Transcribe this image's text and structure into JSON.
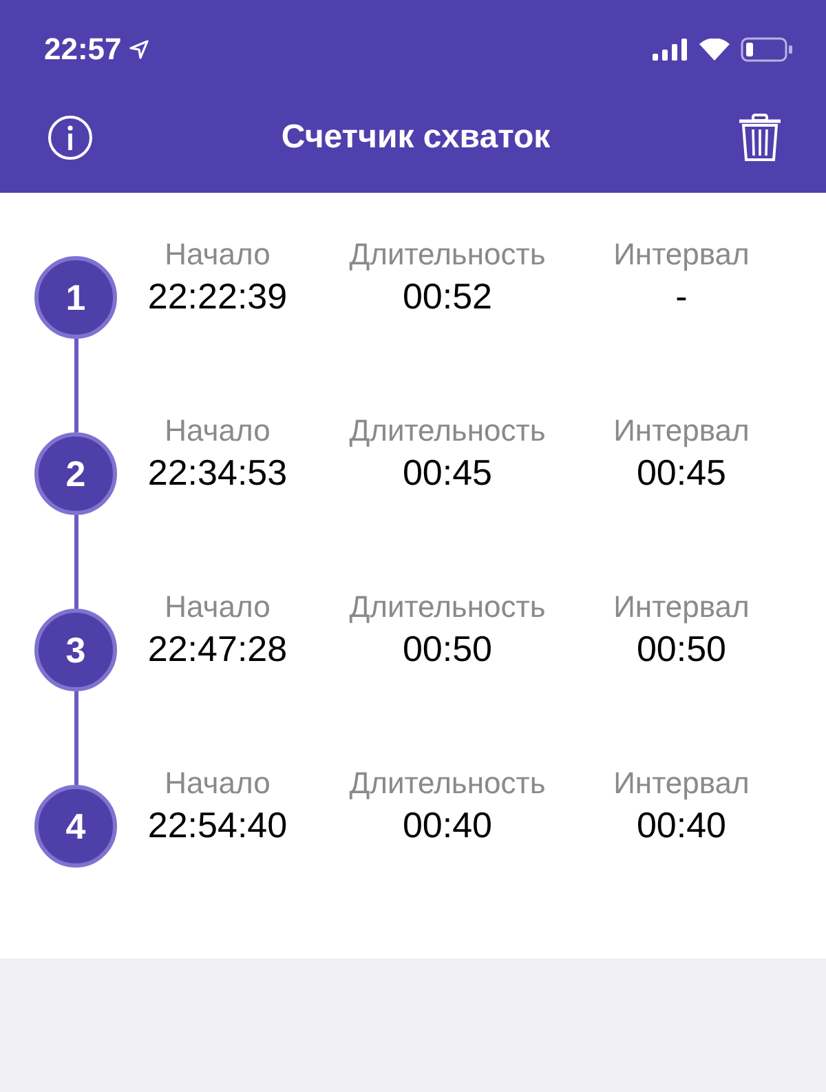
{
  "status_bar": {
    "time": "22:57"
  },
  "header": {
    "title": "Счетчик схваток"
  },
  "contractions": [
    {
      "number": "1",
      "start_label": "Начало",
      "start": "22:22:39",
      "duration_label": "Длительность",
      "duration": "00:52",
      "interval_label": "Интервал",
      "interval": "-"
    },
    {
      "number": "2",
      "start_label": "Начало",
      "start": "22:34:53",
      "duration_label": "Длительность",
      "duration": "00:45",
      "interval_label": "Интервал",
      "interval": "00:45"
    },
    {
      "number": "3",
      "start_label": "Начало",
      "start": "22:47:28",
      "duration_label": "Длительность",
      "duration": "00:50",
      "interval_label": "Интервал",
      "interval": "00:50"
    },
    {
      "number": "4",
      "start_label": "Начало",
      "start": "22:54:40",
      "duration_label": "Длительность",
      "duration": "00:40",
      "interval_label": "Интервал",
      "interval": "00:40"
    }
  ]
}
